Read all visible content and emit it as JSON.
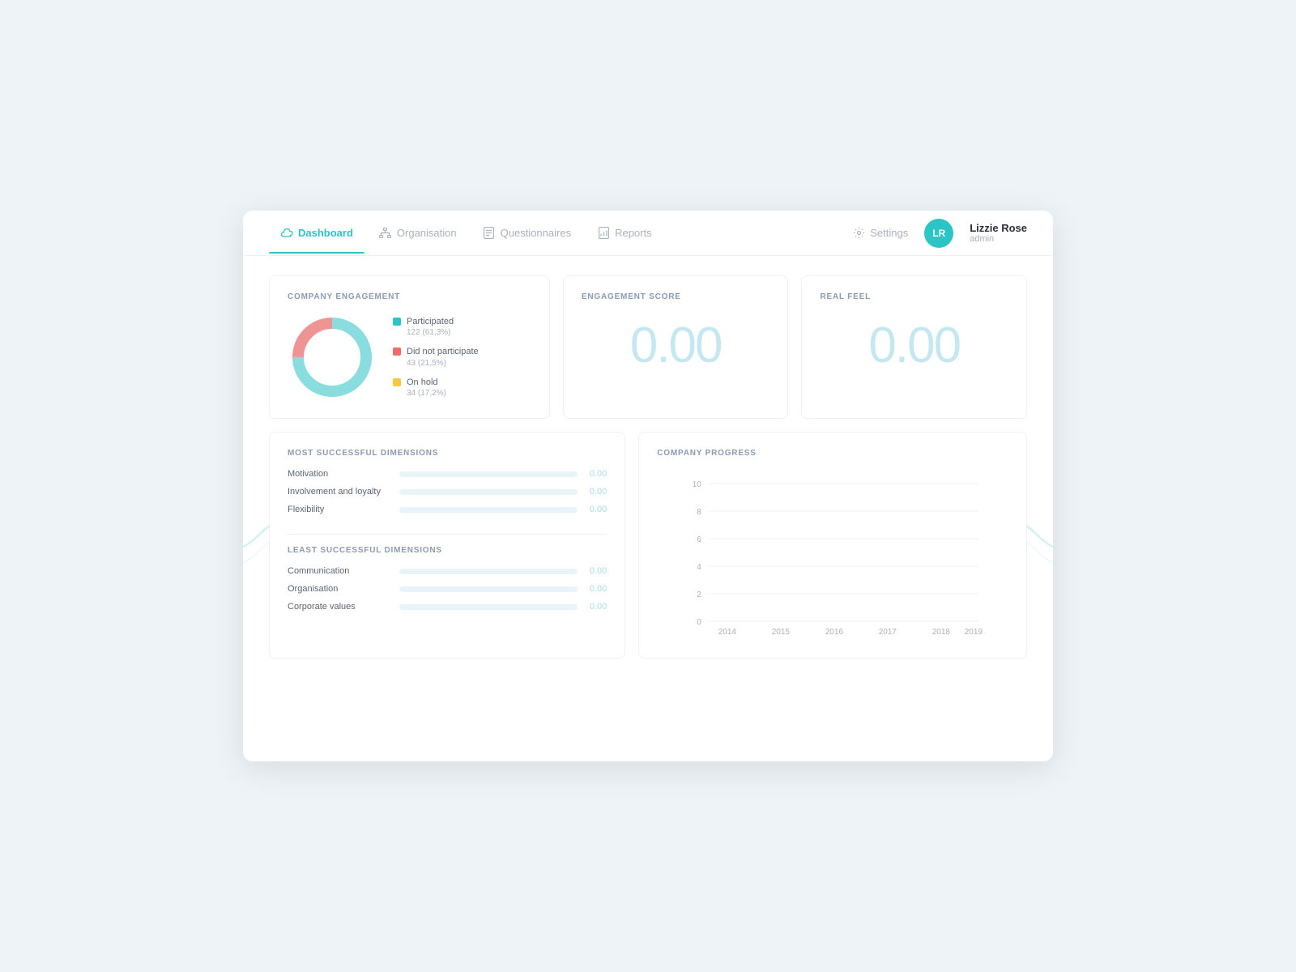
{
  "nav": {
    "items": [
      {
        "label": "Dashboard",
        "icon": "cloud-icon",
        "active": true
      },
      {
        "label": "Organisation",
        "icon": "org-icon",
        "active": false
      },
      {
        "label": "Questionnaires",
        "icon": "questionnaire-icon",
        "active": false
      },
      {
        "label": "Reports",
        "icon": "reports-icon",
        "active": false
      }
    ],
    "settings_label": "Settings",
    "user": {
      "initials": "LR",
      "name": "Lizzie Rose",
      "role": "admin"
    }
  },
  "company_engagement": {
    "title": "COMPANY ENGAGEMENT",
    "legend": [
      {
        "label": "Participated",
        "value": "122 (61,3%)",
        "color": "#2cc5c5"
      },
      {
        "label": "Did not participate",
        "value": "43 (21,5%)",
        "color": "#f26b6b"
      },
      {
        "label": "On hold",
        "value": "34 (17,2%)",
        "color": "#f5c842"
      }
    ],
    "donut": {
      "participated": 61.3,
      "did_not_participate": 21.5,
      "on_hold": 17.2
    }
  },
  "engagement_score": {
    "title": "ENGAGEMENT SCORE",
    "value": "0.00"
  },
  "real_feel": {
    "title": "REAL FEEL",
    "value": "0.00"
  },
  "most_successful": {
    "title": "MOST SUCCESSFUL DIMENSIONS",
    "items": [
      {
        "label": "Motivation",
        "value": "0.00",
        "bar": 0
      },
      {
        "label": "Involvement and loyalty",
        "value": "0.00",
        "bar": 0
      },
      {
        "label": "Flexibility",
        "value": "0.00",
        "bar": 0
      }
    ]
  },
  "least_successful": {
    "title": "LEAST SUCCESSFUL DIMENSIONS",
    "items": [
      {
        "label": "Communication",
        "value": "0.00",
        "bar": 0
      },
      {
        "label": "Organisation",
        "value": "0.00",
        "bar": 0
      },
      {
        "label": "Corporate values",
        "value": "0.00",
        "bar": 0
      }
    ]
  },
  "company_progress": {
    "title": "COMPANY PROGRESS",
    "y_labels": [
      "10",
      "8",
      "6",
      "4",
      "2",
      "0"
    ],
    "x_labels": [
      "2014",
      "2015",
      "2016",
      "2017",
      "2018",
      "2019"
    ]
  }
}
